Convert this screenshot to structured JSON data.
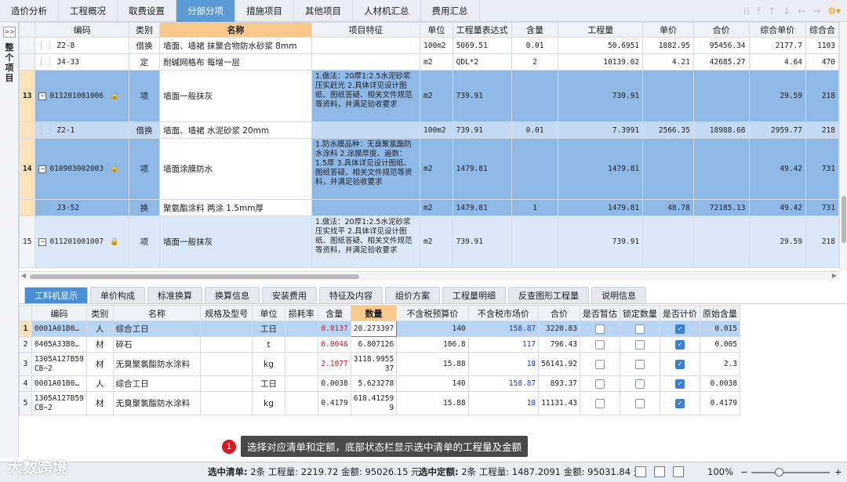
{
  "nav": {
    "tabs": [
      "造价分析",
      "工程概况",
      "取费设置",
      "分部分项",
      "措施项目",
      "其他项目",
      "人材机汇总",
      "费用汇总"
    ],
    "active": "分部分项"
  },
  "sidebar": {
    "label": "整个项目",
    "collapse_label": ">>"
  },
  "grid": {
    "headers": [
      "编码",
      "类别",
      "名称",
      "项目特征",
      "单位",
      "工程量表达式",
      "含量",
      "工程量",
      "单价",
      "合价",
      "综合单价",
      "综合合"
    ],
    "rows": [
      {
        "num": "",
        "code": "Z2-8",
        "type": "借换",
        "name": "墙面、墙裙 抹聚合物防水砂浆 8mm",
        "feature": "",
        "unit": "100m2",
        "expr": "5069.51",
        "content": "0.01",
        "qty": "50.6951",
        "price": "1882.95",
        "total": "95456.34",
        "cprice": "2177.7",
        "ctotal": "1103"
      },
      {
        "num": "",
        "code": "J4-33",
        "type": "定",
        "name": "耐碱网格布 每增一层",
        "feature": "",
        "unit": "m2",
        "expr": "QDL*2",
        "content": "2",
        "qty": "10139.02",
        "price": "4.21",
        "total": "42685.27",
        "cprice": "4.64",
        "ctotal": "470"
      },
      {
        "num": "13",
        "code": "011201001006",
        "type": "项",
        "name": "墙面一般抹灰",
        "feature": "1.做法：20厚1:2.5水泥砂浆压实赶光\n2.具体详见设计图纸、图纸答疑、相关文件规范等资料，并满足验收要求",
        "unit": "m2",
        "expr": "739.91",
        "content": "",
        "qty": "739.91",
        "price": "",
        "total": "",
        "cprice": "29.59",
        "ctotal": "218"
      },
      {
        "num": "",
        "code": "Z2-1",
        "type": "借换",
        "name": "墙面、墙裙 水泥砂浆 20mm",
        "feature": "",
        "unit": "100m2",
        "expr": "739.91",
        "content": "0.01",
        "qty": "7.3991",
        "price": "2566.35",
        "total": "18988.68",
        "cprice": "2959.77",
        "ctotal": "218"
      },
      {
        "num": "14",
        "code": "010903002003",
        "type": "项",
        "name": "墙面涂膜防水",
        "feature": "1.防水膜品种：无臭聚氯酯防水涂料\n2.涂膜厚度、遍数：1.5厚\n3.具体详见设计图纸、图纸答疑、相关文件规范等资料，并满足验收要求",
        "unit": "m2",
        "expr": "1479.81",
        "content": "",
        "qty": "1479.81",
        "price": "",
        "total": "",
        "cprice": "49.42",
        "ctotal": "731"
      },
      {
        "num": "",
        "code": "J3-52",
        "type": "换",
        "name": "聚氨酯涂料 两涂 1.5mm厚",
        "feature": "",
        "unit": "m2",
        "expr": "1479.81",
        "content": "1",
        "qty": "1479.81",
        "price": "48.78",
        "total": "72185.13",
        "cprice": "49.42",
        "ctotal": "731"
      },
      {
        "num": "15",
        "code": "011201001007",
        "type": "项",
        "name": "墙面一般抹灰",
        "feature": "1.做法：20厚1:2.5水泥砂浆压实找平\n2.具体详见设计图纸、图纸答疑、相关文件规范等资料，并满足验收要求",
        "unit": "m2",
        "expr": "739.91",
        "content": "",
        "qty": "739.91",
        "price": "",
        "total": "",
        "cprice": "29.59",
        "ctotal": "218"
      }
    ]
  },
  "bottom_tabs": {
    "items": [
      "工料机显示",
      "单价构成",
      "标准换算",
      "换算信息",
      "安装费用",
      "特征及内容",
      "组价方案",
      "工程量明细",
      "反查图形工程量",
      "说明信息"
    ],
    "active": "工料机显示"
  },
  "res_grid": {
    "headers": [
      "编码",
      "类别",
      "名称",
      "规格及型号",
      "单位",
      "损耗率",
      "含量",
      "数量",
      "不含税预算价",
      "不含税市场价",
      "合价",
      "是否暂估",
      "锁定数量",
      "是否计价",
      "原始含量"
    ],
    "rows": [
      {
        "num": "1",
        "code": "0001A01B0…",
        "type": "人",
        "name": "综合工日",
        "spec": "",
        "unit": "工日",
        "loss": "",
        "content": "0.0137",
        "qty": "20.273397",
        "budget": "140",
        "market": "158.87",
        "total": "3220.83",
        "est": false,
        "lock": false,
        "priced": true,
        "orig": "0.015"
      },
      {
        "num": "2",
        "code": "0405A33B0…",
        "type": "材",
        "name": "碎石",
        "spec": "",
        "unit": "t",
        "loss": "",
        "content": "0.0046",
        "qty": "6.807126",
        "budget": "106.8",
        "market": "117",
        "total": "796.43",
        "est": false,
        "lock": false,
        "priced": true,
        "orig": "0.005"
      },
      {
        "num": "3",
        "code": "1305A127B59 CB~2",
        "type": "材",
        "name": "无臭聚氯酯防水涂料",
        "spec": "",
        "unit": "kg",
        "loss": "",
        "content": "2.1077",
        "qty": "3118.9955 37",
        "budget": "15.88",
        "market": "18",
        "total": "56141.92",
        "est": false,
        "lock": false,
        "priced": true,
        "orig": "2.3"
      },
      {
        "num": "4",
        "code": "0001A01B0…",
        "type": "人",
        "name": "综合工日",
        "spec": "",
        "unit": "工日",
        "loss": "",
        "content": "0.0038",
        "qty": "5.623278",
        "budget": "140",
        "market": "158.87",
        "total": "893.37",
        "est": false,
        "lock": false,
        "priced": true,
        "orig": "0.0038"
      },
      {
        "num": "5",
        "code": "1305A127B59 CB~2",
        "type": "材",
        "name": "无臭聚氯酯防水涂料",
        "spec": "",
        "unit": "kg",
        "loss": "",
        "content": "0.4179",
        "qty": "618.41259 9",
        "budget": "15.88",
        "market": "18",
        "total": "11131.43",
        "est": false,
        "lock": false,
        "priced": true,
        "orig": "0.4179"
      }
    ]
  },
  "toast": {
    "num": "1",
    "text": "选择对应清单和定额，底部状态栏显示选中清单的工程量及金额"
  },
  "status": {
    "list_label": "选中清单:",
    "list_text": "2条 工程量: 2219.72 金额: 95026.15 元",
    "quota_label": "选中定额:",
    "quota_text": "2条 工程量: 1487.2091 金额: 95031.84 元",
    "zoom": "100%"
  },
  "watermark": "大数跨境"
}
